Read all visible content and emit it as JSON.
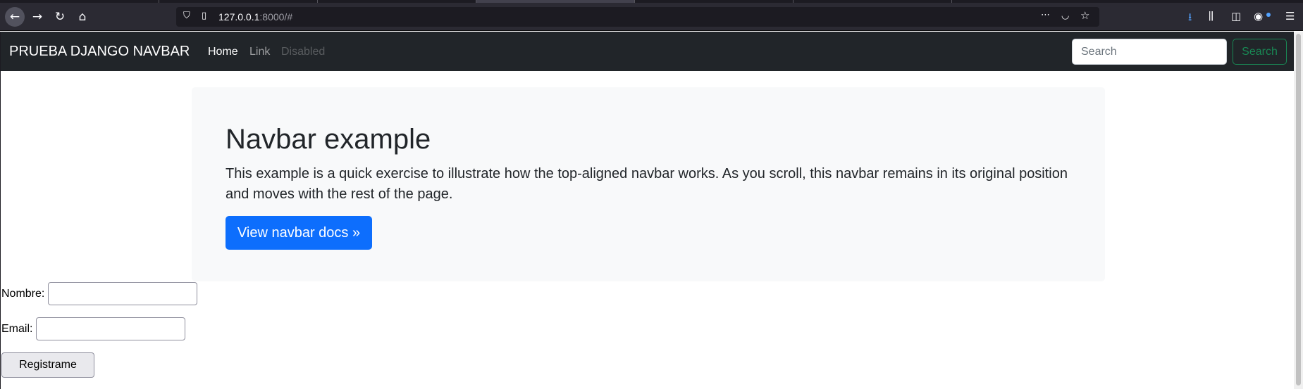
{
  "browser": {
    "url_host": "127.0.0.1",
    "url_rest": ":8000/#",
    "icons": [
      "back-icon",
      "forward-icon",
      "reload-icon",
      "home-icon",
      "shield-icon",
      "page-icon",
      "more-icon",
      "pocket-icon",
      "star-icon",
      "download-icon",
      "library-icon",
      "sidebar-icon",
      "account-icon",
      "menu-icon"
    ]
  },
  "navbar": {
    "brand": "PRUEBA DJANGO NAVBAR",
    "links": [
      {
        "label": "Home",
        "state": "active"
      },
      {
        "label": "Link",
        "state": "normal"
      },
      {
        "label": "Disabled",
        "state": "disabled"
      }
    ],
    "search_placeholder": "Search",
    "search_button": "Search"
  },
  "jumbotron": {
    "title": "Navbar example",
    "lead": "This example is a quick exercise to illustrate how the top-aligned navbar works. As you scroll, this navbar remains in its original position and moves with the rest of the page.",
    "button": "View navbar docs »"
  },
  "form": {
    "nombre_label": "Nombre:",
    "nombre_value": "",
    "email_label": "Email:",
    "email_value": "",
    "submit_label": "Registrame"
  },
  "colors": {
    "navbar_bg": "#212529",
    "primary": "#0d6efd",
    "success": "#198754",
    "jumbotron_bg": "#f8f9fa"
  }
}
